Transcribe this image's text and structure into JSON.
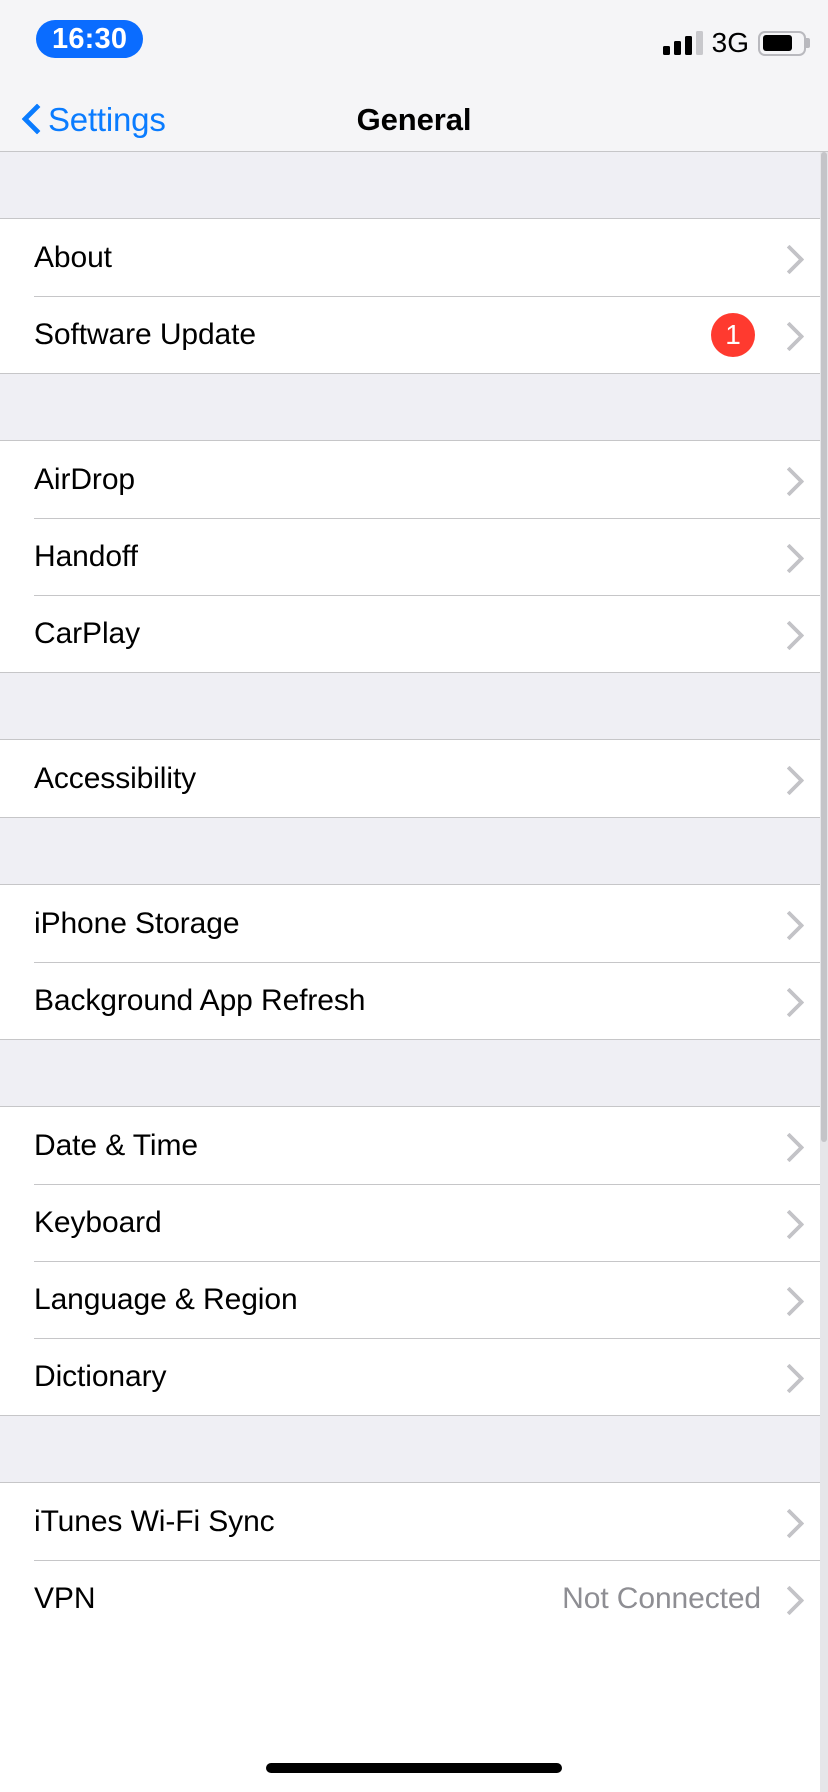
{
  "status_bar": {
    "time": "16:30",
    "carrier_network": "3G",
    "signal_bars_filled": 3,
    "signal_bars_total": 4,
    "battery_level_percent": 76,
    "time_pill_color": "#0a6cff"
  },
  "nav_bar": {
    "back_label": "Settings",
    "title": "General",
    "tint_color": "#0a7cff"
  },
  "sections": [
    {
      "rows": [
        {
          "label": "About",
          "value": "",
          "badge": ""
        },
        {
          "label": "Software Update",
          "value": "",
          "badge": "1"
        }
      ]
    },
    {
      "rows": [
        {
          "label": "AirDrop",
          "value": "",
          "badge": ""
        },
        {
          "label": "Handoff",
          "value": "",
          "badge": ""
        },
        {
          "label": "CarPlay",
          "value": "",
          "badge": ""
        }
      ]
    },
    {
      "rows": [
        {
          "label": "Accessibility",
          "value": "",
          "badge": ""
        }
      ]
    },
    {
      "rows": [
        {
          "label": "iPhone Storage",
          "value": "",
          "badge": ""
        },
        {
          "label": "Background App Refresh",
          "value": "",
          "badge": ""
        }
      ]
    },
    {
      "rows": [
        {
          "label": "Date & Time",
          "value": "",
          "badge": ""
        },
        {
          "label": "Keyboard",
          "value": "",
          "badge": ""
        },
        {
          "label": "Language & Region",
          "value": "",
          "badge": ""
        },
        {
          "label": "Dictionary",
          "value": "",
          "badge": ""
        }
      ]
    },
    {
      "rows": [
        {
          "label": "iTunes Wi-Fi Sync",
          "value": "",
          "badge": ""
        },
        {
          "label": "VPN",
          "value": "Not Connected",
          "badge": ""
        }
      ]
    }
  ],
  "colors": {
    "badge_red": "#ff3a2f",
    "separator": "#c6c6c8",
    "group_background": "#efeff4",
    "chevron_gray": "#c3c3c7",
    "secondary_text": "#8e8e93"
  }
}
